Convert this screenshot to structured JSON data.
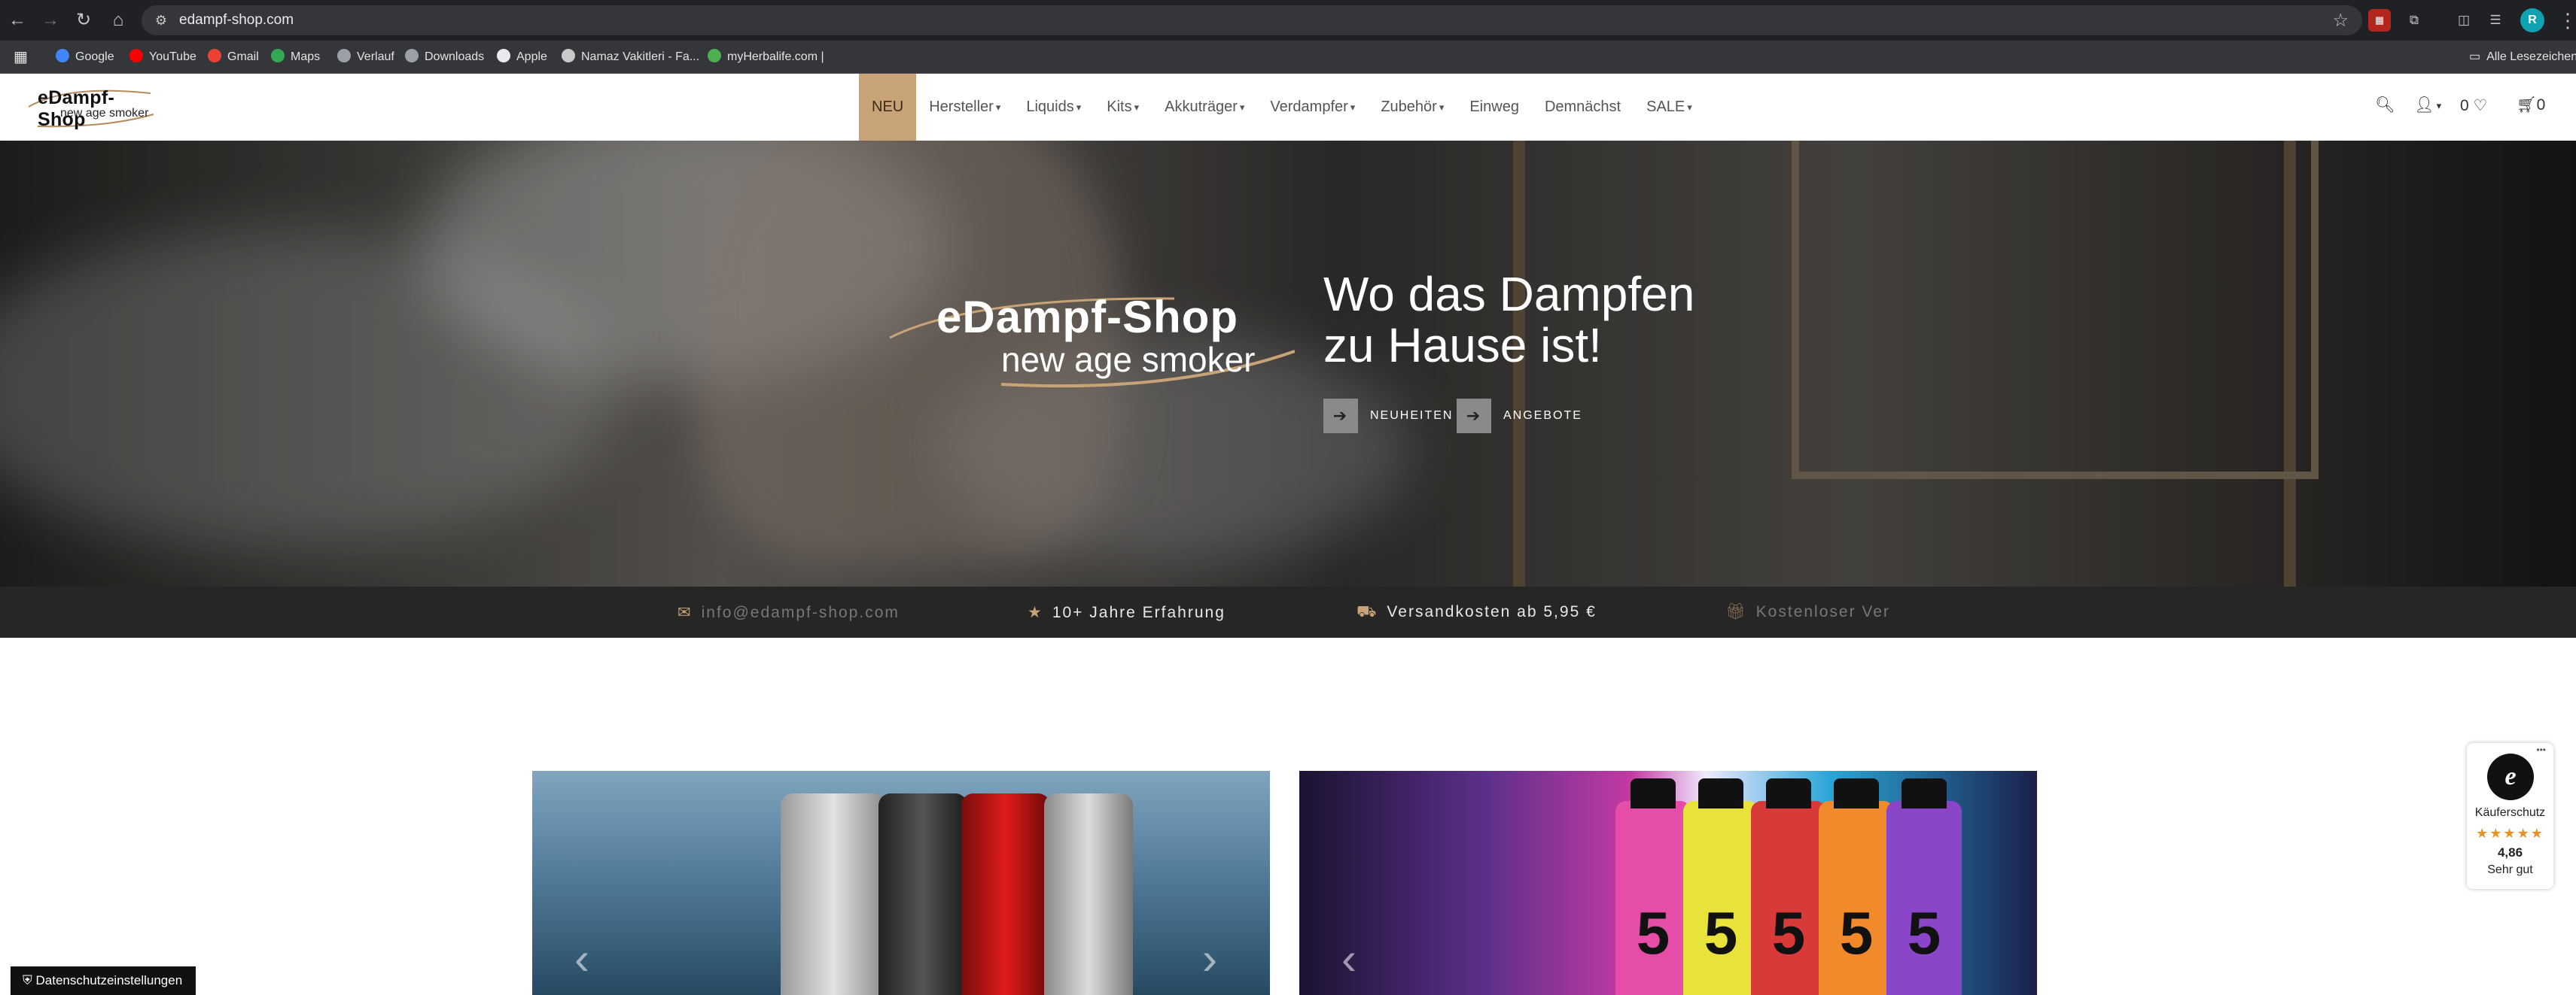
{
  "browser": {
    "url": "edampf-shop.com",
    "bookmarks": [
      {
        "label": "Google",
        "icon": "google-icon",
        "color": "#4285f4"
      },
      {
        "label": "YouTube",
        "icon": "youtube-icon",
        "color": "#ff0000"
      },
      {
        "label": "Gmail",
        "icon": "gmail-icon",
        "color": "#ea4335"
      },
      {
        "label": "Maps",
        "icon": "maps-icon",
        "color": "#34a853"
      },
      {
        "label": "Verlauf",
        "icon": "history-icon",
        "color": "#9aa0a6"
      },
      {
        "label": "Downloads",
        "icon": "download-icon",
        "color": "#9aa0a6"
      },
      {
        "label": "Apple",
        "icon": "apple-icon",
        "color": "#e8eaed"
      },
      {
        "label": "Namaz Vakitleri - Fa...",
        "icon": "globe-icon",
        "color": "#c9c9c9"
      },
      {
        "label": "myHerbalife.com |",
        "icon": "herbalife-icon",
        "color": "#4caf50"
      }
    ],
    "all_bookmarks_label": "Alle Lesezeichen",
    "profile_initial": "R"
  },
  "site": {
    "logo": {
      "line1": "eDampf-Shop",
      "line2": "new age smoker"
    },
    "nav": [
      {
        "label": "NEU",
        "active": true,
        "dropdown": false
      },
      {
        "label": "Hersteller",
        "dropdown": true
      },
      {
        "label": "Liquids",
        "dropdown": true
      },
      {
        "label": "Kits",
        "dropdown": true
      },
      {
        "label": "Akkuträger",
        "dropdown": true
      },
      {
        "label": "Verdampfer",
        "dropdown": true
      },
      {
        "label": "Zubehör",
        "dropdown": true
      },
      {
        "label": "Einweg",
        "dropdown": false
      },
      {
        "label": "Demnächst",
        "dropdown": false
      },
      {
        "label": "SALE",
        "dropdown": true
      }
    ],
    "header_icons": {
      "wishlist_count": "0",
      "cart_count": "0"
    }
  },
  "hero": {
    "logo_line1": "eDampf-Shop",
    "logo_line2": "new age smoker",
    "title_line1": "Wo das Dampfen",
    "title_line2": "zu Hause ist!",
    "buttons": [
      {
        "label": "NEUHEITEN"
      },
      {
        "label": "ANGEBOTE"
      }
    ]
  },
  "info_strip": [
    {
      "text": "info@edampf-shop.com",
      "icon": "mail-icon"
    },
    {
      "text": "10+ Jahre Erfahrung",
      "icon": "star-icon"
    },
    {
      "text": "Versandkosten ab 5,95 €",
      "icon": "truck-icon"
    },
    {
      "text": "Kostenloser Ver",
      "icon": "gift-icon"
    }
  ],
  "trust_badge": {
    "label": "Käuferschutz",
    "score": "4,86",
    "verdict": "Sehr gut",
    "stars": "★★★★★",
    "seal_letter": "e"
  },
  "privacy_button": "Datenschutzeinstellungen",
  "colors": {
    "accent": "#c9a378",
    "dark_strip": "#262626",
    "browser_bg": "#202124"
  }
}
